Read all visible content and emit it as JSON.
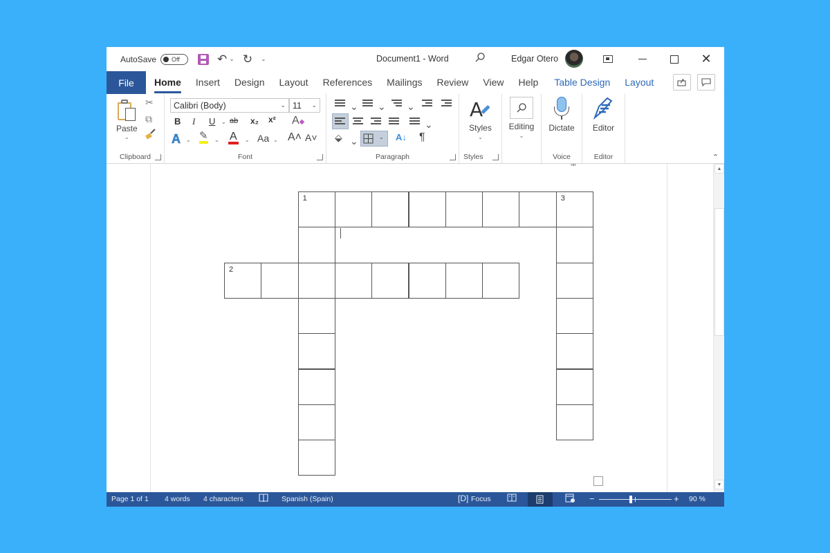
{
  "titlebar": {
    "autosave_label": "AutoSave",
    "autosave_state": "Off",
    "document_title": "Document1  -  Word",
    "user_name": "Edgar Otero",
    "icons": {
      "save": "save-icon",
      "undo": "↶",
      "undo_dropdown": "⌄",
      "redo": "↻",
      "customize": "⌄",
      "search": "⚲",
      "close": "✕"
    }
  },
  "tabs": {
    "file": "File",
    "items": [
      "Home",
      "Insert",
      "Design",
      "Layout",
      "References",
      "Mailings",
      "Review",
      "View",
      "Help"
    ],
    "contextual": [
      "Table Design",
      "Layout"
    ],
    "active": "Home",
    "share_icon": "⇪",
    "comment_icon": "▭"
  },
  "ribbon": {
    "clipboard": {
      "label": "Clipboard",
      "paste": "Paste",
      "cut_icon": "✂",
      "copy_icon": "⧉",
      "format_painter_icon": "🖌"
    },
    "font": {
      "label": "Font",
      "font_name": "Calibri (Body)",
      "font_size": "11",
      "bold": "B",
      "italic": "I",
      "underline": "U",
      "strikethrough": "ab",
      "subscript": "x₂",
      "superscript": "x²",
      "clear_formatting": "A",
      "text_effects": "A",
      "highlight": "✎",
      "font_color": "A",
      "change_case": "Aa",
      "grow": "A˄",
      "shrink": "A˅",
      "highlight_color": "#f5f019",
      "font_color_value": "#e02020"
    },
    "paragraph": {
      "label": "Paragraph",
      "sort": "A↓",
      "pilcrow": "¶",
      "shading_icon": "⬙"
    },
    "styles": {
      "label": "Styles",
      "button": "Styles"
    },
    "editing": {
      "button": "Editing"
    },
    "voice": {
      "label": "Voice",
      "button": "Dictate"
    },
    "editor": {
      "label": "Editor",
      "button": "Editor"
    }
  },
  "document": {
    "ruler_mark": "IVI",
    "crossword": {
      "clue_numbers": [
        "1",
        "2",
        "3"
      ],
      "word_1_across_length": 8,
      "word_2_across_length": 8,
      "word_1_down_length": 8,
      "word_3_down_length": 7
    }
  },
  "statusbar": {
    "page": "Page 1 of 1",
    "words": "4 words",
    "characters": "4 characters",
    "language": "Spanish (Spain)",
    "focus": "Focus",
    "zoom_minus": "−",
    "zoom_plus": "+",
    "zoom_level": "90 %",
    "zoom_percent": 90
  },
  "colors": {
    "background": "#3ab0fb",
    "accent": "#2b579a",
    "contextual_tab": "#2b68b8"
  }
}
